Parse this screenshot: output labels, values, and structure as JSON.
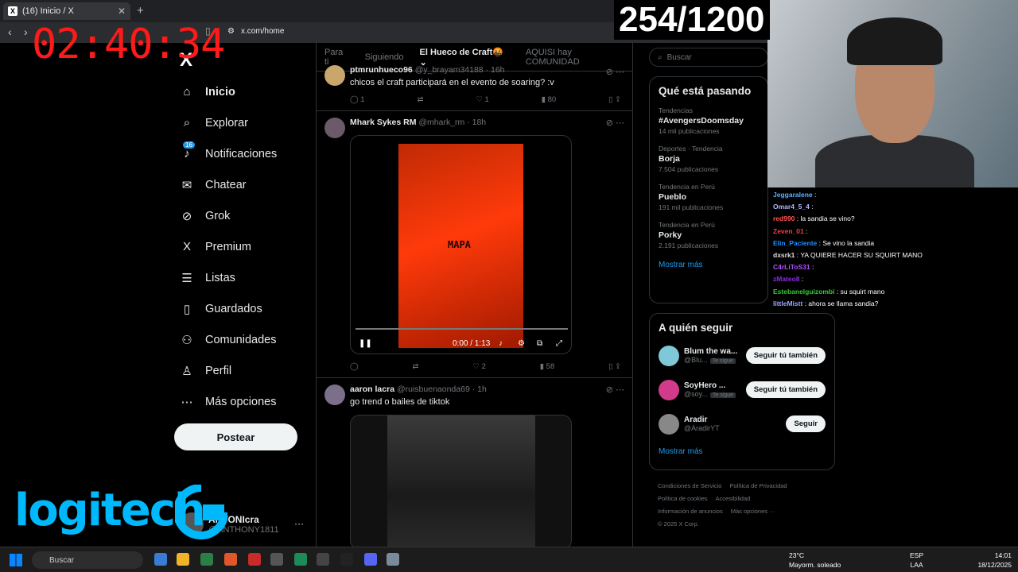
{
  "browser": {
    "tab_title": "(16) Inicio / X",
    "tab_favicon": "X",
    "new_tab": "+",
    "url": "x.com/home"
  },
  "overlay": {
    "timer": "02:40:34",
    "counter": "254/1200",
    "sponsor": "logitech"
  },
  "nav": {
    "logo": "X",
    "items": [
      {
        "label": "Inicio",
        "icon": "⌂"
      },
      {
        "label": "Explorar",
        "icon": "⌕"
      },
      {
        "label": "Notificaciones",
        "icon": "♪",
        "badge": "16"
      },
      {
        "label": "Chatear",
        "icon": "✉"
      },
      {
        "label": "Grok",
        "icon": "⊘"
      },
      {
        "label": "Premium",
        "icon": "X"
      },
      {
        "label": "Listas",
        "icon": "☰"
      },
      {
        "label": "Guardados",
        "icon": "▯"
      },
      {
        "label": "Comunidades",
        "icon": "⚇"
      },
      {
        "label": "Perfil",
        "icon": "♙"
      },
      {
        "label": "Más opciones",
        "icon": "⋯"
      }
    ],
    "post_button": "Postear",
    "profile_name": "ANTONIcra",
    "profile_handle": "@ANTHONY1811",
    "profile_more": "···"
  },
  "feed": {
    "tabs": [
      "Para ti",
      "Siguiendo",
      "El Hueco de Craft🤬",
      "AQUISI hay COMUNIDAD"
    ],
    "posts": [
      {
        "name": "ptmrunhueco96",
        "handle": "@y_brayam34188 · 16h",
        "text": "chicos el craft participará en el evento de soaring? :v",
        "replies": "1",
        "reposts": "",
        "likes": "1",
        "views": "80"
      },
      {
        "name": "Mhark Sykes RM",
        "handle": "@mhark_rm · 18h",
        "text": "",
        "video_text": "MAPA",
        "video_time": "0:00 / 1:13",
        "replies": "",
        "reposts": "",
        "likes": "2",
        "views": "58"
      },
      {
        "name": "aaron lacra",
        "handle": "@ruisbuenaonda69 · 1h",
        "text": "go trend o bailes de tiktok"
      }
    ]
  },
  "right": {
    "search_placeholder": "Buscar",
    "trends_title": "Qué está pasando",
    "trends": [
      {
        "category": "Tendencias",
        "name": "#AvengersDoomsday",
        "count": "14 mil publicaciones"
      },
      {
        "category": "Deportes · Tendencia",
        "name": "Borja",
        "count": "7.504 publicaciones"
      },
      {
        "category": "Tendencia en Perú",
        "name": "Pueblo",
        "count": "191 mil publicaciones"
      },
      {
        "category": "Tendencia en Perú",
        "name": "Porky",
        "count": "2.191 publicaciones"
      }
    ],
    "show_more": "Mostrar más",
    "follow_title": "A quién seguir",
    "follow": [
      {
        "name": "Blum the wa...",
        "handle": "@Blu...",
        "follows_you": "Te sigue",
        "button": "Seguir tú también",
        "color": "#7ec8d8"
      },
      {
        "name": "SoyHero ...",
        "handle": "@soy...",
        "follows_you": "Te sigue",
        "button": "Seguir tú también",
        "color": "#d23a8a"
      },
      {
        "name": "Aradir",
        "handle": "@AradirYT",
        "follows_you": "",
        "button": "Seguir",
        "color": "#888888"
      }
    ],
    "footer": [
      "Condiciones de Servicio",
      "Política de Privacidad",
      "Política de cookies",
      "Accesibilidad",
      "Información de anuncios",
      "Más opciones ···",
      "© 2025 X Corp."
    ]
  },
  "chat": [
    {
      "name": "Jeggaralene",
      "msg": ":",
      "color": "#5ab3ff"
    },
    {
      "name": "Omar4_5_4",
      "msg": ":",
      "color": "#b5b5ff"
    },
    {
      "name": "red990",
      "msg": ": la sandia se vino?",
      "color": "#ff5555"
    },
    {
      "name": "Zeven_01",
      "msg": ":",
      "color": "#ff3b3b"
    },
    {
      "name": "Elin_Paciente",
      "msg": ": Se vino la sandia",
      "color": "#1e90ff"
    },
    {
      "name": "dxsrk1",
      "msg": ": YA QUIERE HACER SU SQUIRT MANO",
      "color": "#dddddd"
    },
    {
      "name": "C4rLiToS31",
      "msg": ":",
      "color": "#b050ff"
    },
    {
      "name": "zMateo8",
      "msg": ":",
      "color": "#8a2be2"
    },
    {
      "name": "Estebanelguizombi",
      "msg": ": su squirt mano",
      "color": "#32cd32"
    },
    {
      "name": "littleMistt",
      "msg": ": ahora se llama sandia?",
      "color": "#9aa8ff"
    }
  ],
  "taskbar": {
    "search": "Buscar",
    "temp": "23°C",
    "weather": "Mayorm. soleado",
    "lang1": "ESP",
    "lang2": "LAA",
    "time": "14:01",
    "date": "18/12/2025"
  }
}
